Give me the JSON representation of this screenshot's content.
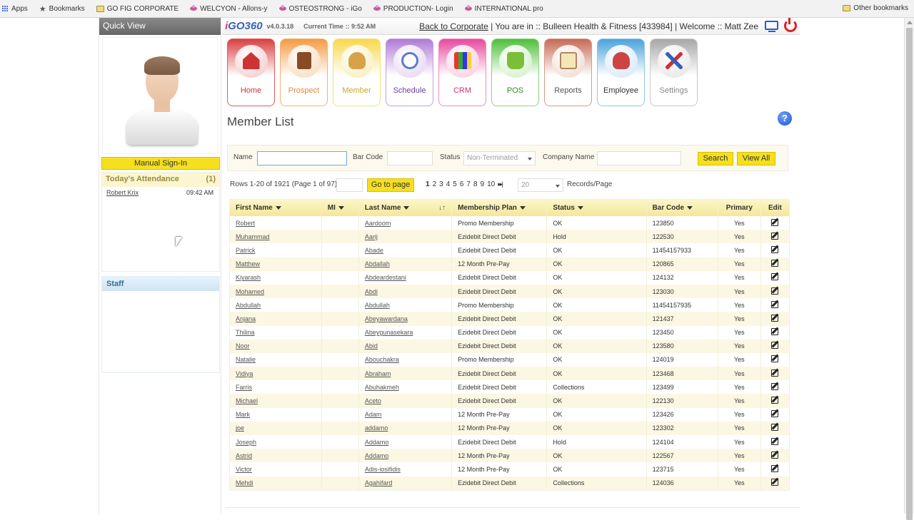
{
  "bookmarks": {
    "items": [
      {
        "label": "Apps",
        "icon": "apps-icon"
      },
      {
        "label": "Bookmarks",
        "icon": "star-icon"
      },
      {
        "label": "GO FIG CORPORATE",
        "icon": "folder-icon"
      },
      {
        "label": "WELCYON - Allons-y",
        "icon": "favicon"
      },
      {
        "label": "OSTEOSTRONG - iGo",
        "icon": "favicon"
      },
      {
        "label": "PRODUCTION- Login",
        "icon": "favicon"
      },
      {
        "label": "INTERNATIONAL pro",
        "icon": "favicon"
      }
    ],
    "other": "Other bookmarks"
  },
  "quick_view": {
    "title": "Quick View",
    "manual_sign_in": "Manual Sign-In",
    "attendance_title": "Today's Attendance",
    "attendance_count": "(1)",
    "attendance": [
      {
        "name": "Robert Krix",
        "time": "09:42 AM"
      }
    ],
    "staff_title": "Staff"
  },
  "header": {
    "logo_i": "i",
    "logo_go": "GO",
    "logo_num": "360",
    "version": "v4.0.3.18",
    "current_time_label": "Current Time ::",
    "current_time": "9:52 AM",
    "back_link": "Back to Corporate",
    "location": " | You are in :: Bulleen Health & Fitness [433984] | Welcome :: Matt Zee"
  },
  "nav": [
    {
      "label": "Home",
      "name": "home"
    },
    {
      "label": "Prospect",
      "name": "prospect"
    },
    {
      "label": "Member",
      "name": "member"
    },
    {
      "label": "Schedule",
      "name": "schedule"
    },
    {
      "label": "CRM",
      "name": "crm"
    },
    {
      "label": "POS",
      "name": "pos"
    },
    {
      "label": "Reports",
      "name": "reports"
    },
    {
      "label": "Employee",
      "name": "employee"
    },
    {
      "label": "Settings",
      "name": "settings"
    }
  ],
  "page": {
    "title": "Member List",
    "help": "?"
  },
  "search": {
    "name_label": "Name",
    "name_value": "",
    "barcode_label": "Bar Code",
    "barcode_value": "",
    "status_label": "Status",
    "status_value": "Non-Terminated",
    "company_label": "Company Name",
    "company_value": "",
    "search_button": "Search",
    "view_all_button": "View All"
  },
  "paging": {
    "rows_text": "Rows 1-20 of 1921 (Page 1 of 97)",
    "page_input": "",
    "go_button": "Go to page",
    "pages": [
      "1",
      "2",
      "3",
      "4",
      "5",
      "6",
      "7",
      "8",
      "9",
      "10"
    ],
    "last_symbol": "▸▸|",
    "records_per_page": "20",
    "records_label": "Records/Page"
  },
  "table": {
    "columns": [
      "First Name",
      "MI",
      "Last Name",
      "Membership Plan",
      "Status",
      "Bar Code",
      "Primary",
      "Edit"
    ],
    "rows": [
      {
        "first": "Robert",
        "mi": "",
        "last": "Aardoom",
        "plan": "Promo Membership",
        "status": "OK",
        "barcode": "123850",
        "primary": "Yes"
      },
      {
        "first": "Muhammad",
        "mi": "",
        "last": "Aarij",
        "plan": "Ezidebit Direct Debit",
        "status": "Hold",
        "barcode": "122530",
        "primary": "Yes"
      },
      {
        "first": "Patrick",
        "mi": "",
        "last": "Abade",
        "plan": "Ezidebit Direct Debit",
        "status": "OK",
        "barcode": "11454157933",
        "primary": "Yes"
      },
      {
        "first": "Matthew",
        "mi": "",
        "last": "Abdallah",
        "plan": "12 Month Pre-Pay",
        "status": "OK",
        "barcode": "120865",
        "primary": "Yes"
      },
      {
        "first": "Kiyarash",
        "mi": "",
        "last": "Abdeardestani",
        "plan": "Ezidebit Direct Debit",
        "status": "OK",
        "barcode": "124132",
        "primary": "Yes"
      },
      {
        "first": "Mohamed",
        "mi": "",
        "last": "Abdi",
        "plan": "Ezidebit Direct Debit",
        "status": "OK",
        "barcode": "123030",
        "primary": "Yes"
      },
      {
        "first": "Abdullah",
        "mi": "",
        "last": "Abdullah",
        "plan": "Promo Membership",
        "status": "OK",
        "barcode": "11454157935",
        "primary": "Yes"
      },
      {
        "first": "Anjana",
        "mi": "",
        "last": "Abeyawardana",
        "plan": "Ezidebit Direct Debit",
        "status": "OK",
        "barcode": "121437",
        "primary": "Yes"
      },
      {
        "first": "Thilina",
        "mi": "",
        "last": "Abeygunasekara",
        "plan": "Ezidebit Direct Debit",
        "status": "OK",
        "barcode": "123450",
        "primary": "Yes"
      },
      {
        "first": "Noor",
        "mi": "",
        "last": "Abid",
        "plan": "Ezidebit Direct Debit",
        "status": "OK",
        "barcode": "123580",
        "primary": "Yes"
      },
      {
        "first": "Natalie",
        "mi": "",
        "last": "Abouchakra",
        "plan": "Promo Membership",
        "status": "OK",
        "barcode": "124019",
        "primary": "Yes"
      },
      {
        "first": "Vidiya",
        "mi": "",
        "last": "Abraham",
        "plan": "Ezidebit Direct Debit",
        "status": "OK",
        "barcode": "123468",
        "primary": "Yes"
      },
      {
        "first": "Farris",
        "mi": "",
        "last": "Abuhakmeh",
        "plan": "Ezidebit Direct Debit",
        "status": "Collections",
        "barcode": "123499",
        "primary": "Yes"
      },
      {
        "first": "Michael",
        "mi": "",
        "last": "Aceto",
        "plan": "Ezidebit Direct Debit",
        "status": "OK",
        "barcode": "122130",
        "primary": "Yes"
      },
      {
        "first": "Mark",
        "mi": "",
        "last": "Adam",
        "plan": "12 Month Pre-Pay",
        "status": "OK",
        "barcode": "123426",
        "primary": "Yes"
      },
      {
        "first": "joe",
        "mi": "",
        "last": "addamo",
        "plan": "12 Month Pre-Pay",
        "status": "OK",
        "barcode": "123302",
        "primary": "Yes"
      },
      {
        "first": "Joseph",
        "mi": "",
        "last": "Addamo",
        "plan": "Ezidebit Direct Debit",
        "status": "Hold",
        "barcode": "124104",
        "primary": "Yes"
      },
      {
        "first": "Astrid",
        "mi": "",
        "last": "Addamo",
        "plan": "12 Month Pre-Pay",
        "status": "OK",
        "barcode": "122567",
        "primary": "Yes"
      },
      {
        "first": "Victor",
        "mi": "",
        "last": "Adis-iosifidis",
        "plan": "12 Month Pre-Pay",
        "status": "OK",
        "barcode": "123715",
        "primary": "Yes"
      },
      {
        "first": "Mehdi",
        "mi": "",
        "last": "Agahifard",
        "plan": "Ezidebit Direct Debit",
        "status": "Collections",
        "barcode": "124036",
        "primary": "Yes"
      }
    ]
  }
}
